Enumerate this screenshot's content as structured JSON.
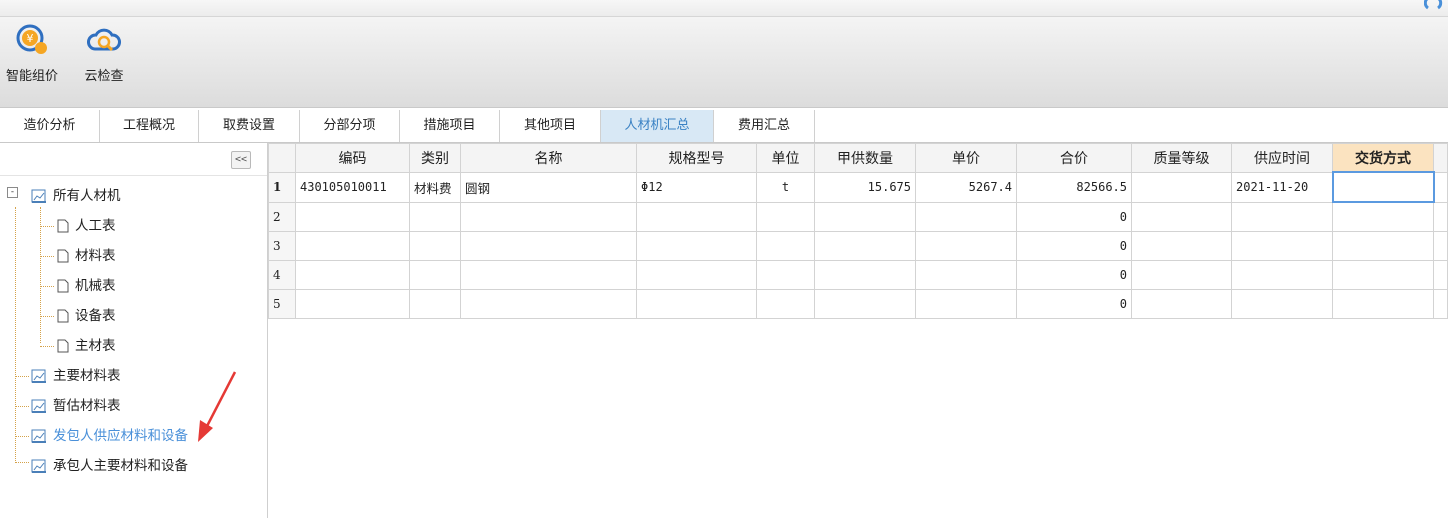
{
  "toolbar": {
    "items": [
      {
        "label": "智能组价",
        "icon": "smart-pricing-icon"
      },
      {
        "label": "云检查",
        "icon": "cloud-check-icon"
      }
    ]
  },
  "tabs": [
    {
      "label": "造价分析",
      "active": false
    },
    {
      "label": "工程概况",
      "active": false
    },
    {
      "label": "取费设置",
      "active": false
    },
    {
      "label": "分部分项",
      "active": false
    },
    {
      "label": "措施项目",
      "active": false
    },
    {
      "label": "其他项目",
      "active": false
    },
    {
      "label": "人材机汇总",
      "active": true
    },
    {
      "label": "费用汇总",
      "active": false
    }
  ],
  "sidebar": {
    "collapse_label": "<<",
    "expander_label": "-",
    "tree": [
      {
        "label": "所有人材机",
        "icon": "folder-chart-icon"
      },
      {
        "label": "人工表",
        "icon": "document-icon"
      },
      {
        "label": "材料表",
        "icon": "document-icon"
      },
      {
        "label": "机械表",
        "icon": "document-icon"
      },
      {
        "label": "设备表",
        "icon": "document-icon"
      },
      {
        "label": "主材表",
        "icon": "document-icon"
      },
      {
        "label": "主要材料表",
        "icon": "folder-chart-icon"
      },
      {
        "label": "暂估材料表",
        "icon": "folder-chart-icon"
      },
      {
        "label": "发包人供应材料和设备",
        "icon": "folder-chart-icon",
        "highlight": true
      },
      {
        "label": "承包人主要材料和设备",
        "icon": "folder-chart-icon"
      }
    ]
  },
  "grid": {
    "columns": [
      "编码",
      "类别",
      "名称",
      "规格型号",
      "单位",
      "甲供数量",
      "单价",
      "合价",
      "质量等级",
      "供应时间",
      "交货方式"
    ],
    "rows": [
      {
        "num": "1",
        "code": "430105010011",
        "category": "材料费",
        "name": "圆钢",
        "spec": "Φ12",
        "unit": "t",
        "qty": "15.675",
        "price": "5267.4",
        "total": "82566.5",
        "quality": "",
        "date": "2021-11-20",
        "delivery": ""
      },
      {
        "num": "2",
        "code": "",
        "category": "",
        "name": "",
        "spec": "",
        "unit": "",
        "qty": "",
        "price": "",
        "total": "0",
        "quality": "",
        "date": "",
        "delivery": ""
      },
      {
        "num": "3",
        "code": "",
        "category": "",
        "name": "",
        "spec": "",
        "unit": "",
        "qty": "",
        "price": "",
        "total": "0",
        "quality": "",
        "date": "",
        "delivery": ""
      },
      {
        "num": "4",
        "code": "",
        "category": "",
        "name": "",
        "spec": "",
        "unit": "",
        "qty": "",
        "price": "",
        "total": "0",
        "quality": "",
        "date": "",
        "delivery": ""
      },
      {
        "num": "5",
        "code": "",
        "category": "",
        "name": "",
        "spec": "",
        "unit": "",
        "qty": "",
        "price": "",
        "total": "0",
        "quality": "",
        "date": "",
        "delivery": ""
      }
    ]
  },
  "colors": {
    "accent": "#4a90d9",
    "active_tab_bg": "#d8e8f5",
    "header_highlight": "#fbe3c0",
    "arrow": "#e53935",
    "tree_line": "#d4a24a"
  }
}
